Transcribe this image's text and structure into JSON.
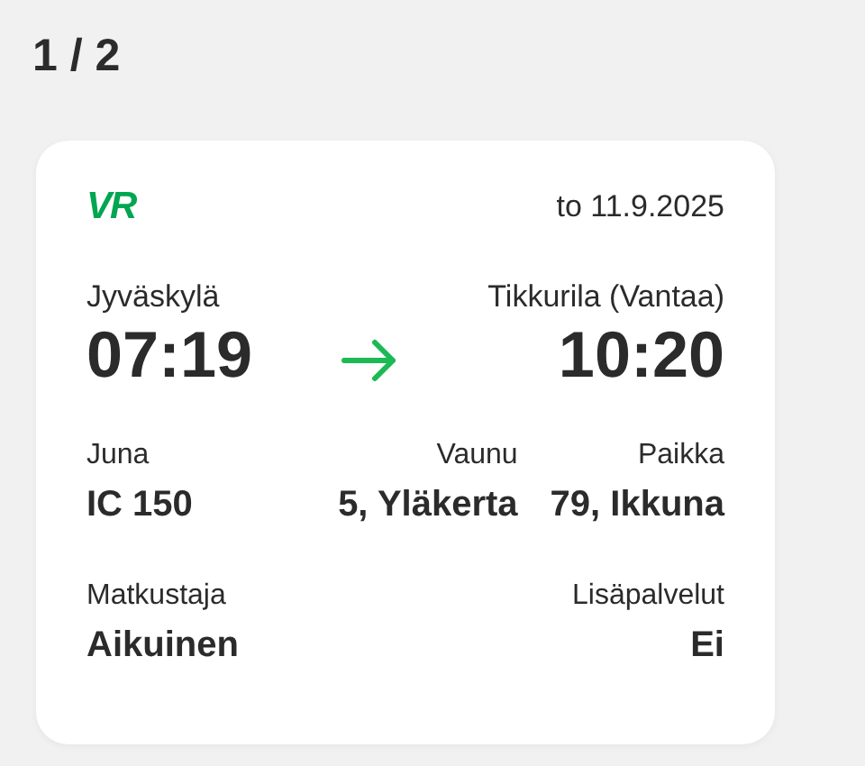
{
  "pager": "1 / 2",
  "ticket": {
    "logo": "VR",
    "date": "to 11.9.2025",
    "from": {
      "station": "Jyväskylä",
      "time": "07:19"
    },
    "to": {
      "station": "Tikkurila (Vantaa)",
      "time": "10:20"
    },
    "details": [
      {
        "label": "Juna",
        "value": "IC 150"
      },
      {
        "label": "Vaunu",
        "value": "5, Yläkerta"
      },
      {
        "label": "Paikka",
        "value": "79, Ikkuna"
      }
    ],
    "extras": [
      {
        "label": "Matkustaja",
        "value": "Aikuinen"
      },
      {
        "label": "Lisäpalvelut",
        "value": "Ei"
      }
    ]
  }
}
